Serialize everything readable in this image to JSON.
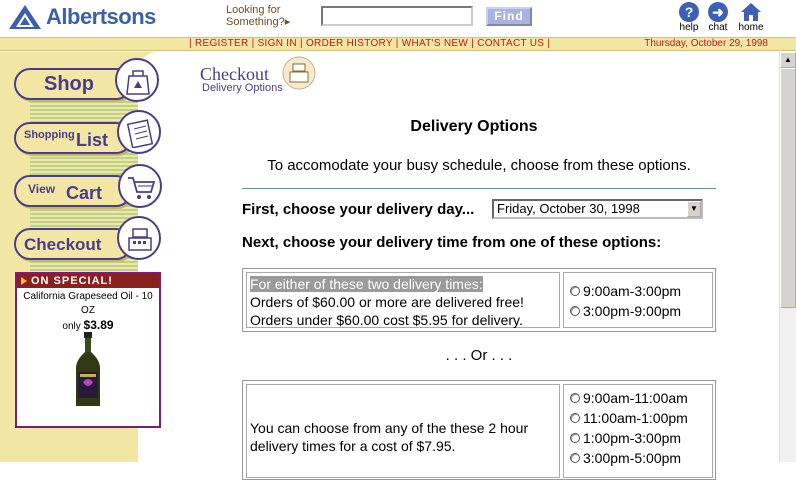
{
  "header": {
    "brand": "Albertsons",
    "looking_for": [
      "Looking for",
      "Something?"
    ],
    "search_placeholder": "",
    "find_label": "Find",
    "icons": [
      {
        "label": "help",
        "icon": "question-icon"
      },
      {
        "label": "chat",
        "icon": "arrow-right-icon"
      },
      {
        "label": "home",
        "icon": "home-icon"
      }
    ]
  },
  "navbar": {
    "links": [
      "REGISTER",
      "SIGN IN",
      "ORDER HISTORY",
      "WHAT'S NEW",
      "CONTACT US"
    ],
    "date": "Thursday, October 29, 1998"
  },
  "sidebar": {
    "shop": "Shop",
    "shopping_list_small": "Shopping",
    "shopping_list_big": "List",
    "view_cart_small": "View",
    "view_cart_big": "Cart",
    "checkout": "Checkout",
    "special": {
      "heading": "ON SPECIAL!",
      "product": "California Grapeseed Oil - 10 OZ",
      "only": "only",
      "price": "$3.89"
    }
  },
  "main": {
    "section_title": "Checkout",
    "section_subtitle": "Delivery Options",
    "page_title": "Delivery Options",
    "intro": "To accomodate your busy schedule, choose from these options.",
    "first_label": "First, choose your delivery day...",
    "day_value": "Friday, October 30, 1998",
    "next_label": "Next, choose your delivery time from one of these options:",
    "option1": {
      "line1": "For either of these two delivery times:",
      "line2": "Orders of $60.00 or more are delivered free!",
      "line3": "Orders under $60.00 cost $5.95 for delivery.",
      "times": [
        "9:00am-3:00pm",
        "3:00pm-9:00pm"
      ]
    },
    "or_text": ". . . Or . . .",
    "option2": {
      "line1": "You can choose from any of the these 2 hour",
      "line2": "delivery times for a cost of $7.95.",
      "times": [
        "9:00am-11:00am",
        "11:00am-1:00pm",
        "1:00pm-3:00pm",
        "3:00pm-5:00pm"
      ]
    }
  }
}
